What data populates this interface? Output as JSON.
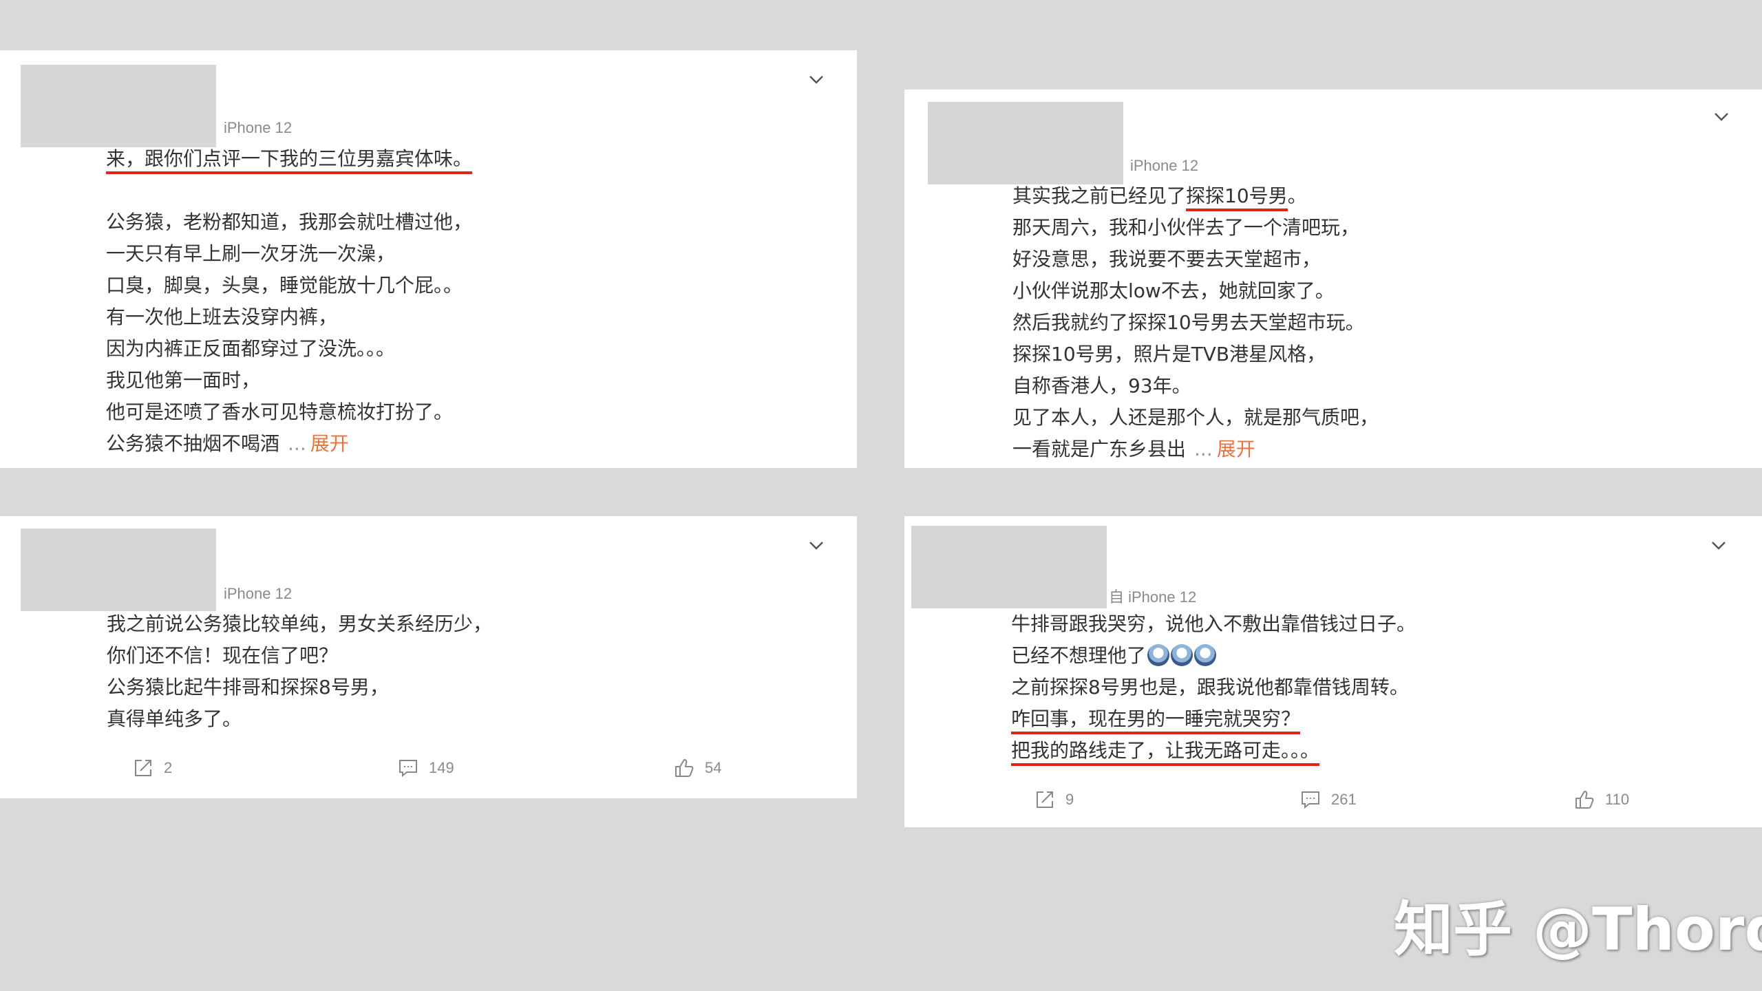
{
  "watermark": "知乎 @Thord",
  "cards": [
    {
      "device": "iPhone 12",
      "headline": "来，跟你们点评一下我的三位男嘉宾体味。",
      "lines": [
        "公务猿，老粉都知道，我那会就吐槽过他，",
        "一天只有早上刷一次牙洗一次澡，",
        "口臭，脚臭，头臭，睡觉能放十几个屁。。",
        "有一次他上班去没穿内裤，",
        "因为内裤正反面都穿过了没洗。。。",
        "我见他第一面时，",
        "他可是还喷了香水可见特意梳妆打扮了。",
        "公务猿不抽烟不喝酒"
      ],
      "more": "...",
      "expand": "展开"
    },
    {
      "device": "iPhone 12",
      "first_prefix": "其实我之前已经见了",
      "first_highlight": "探探10号男",
      "first_suffix": "。",
      "lines": [
        "那天周六，我和小伙伴去了一个清吧玩，",
        "好没意思，我说要不要去天堂超市，",
        "小伙伴说那太low不去，她就回家了。",
        "然后我就约了探探10号男去天堂超市玩。",
        "探探10号男，照片是TVB港星风格，",
        "自称香港人，93年。",
        "见了本人，人还是那个人，就是那气质吧，",
        "一看就是广东乡县出"
      ],
      "more": "...",
      "expand": "展开"
    },
    {
      "device": "iPhone 12",
      "lines": [
        "我之前说公务猿比较单纯，男女关系经历少，",
        "你们还不信！现在信了吧？",
        "公务猿比起牛排哥和探探8号男，",
        "真得单纯多了。"
      ],
      "share_count": "2",
      "comment_count": "149",
      "like_count": "54"
    },
    {
      "device": "自 iPhone 12",
      "lines": [
        "牛排哥跟我哭穷，说他入不敷出靠借钱过日子。",
        "已经不想理他了",
        "之前探探8号男也是，跟我说他都靠借钱周转。"
      ],
      "highlight_lines": [
        "咋回事，现在男的一睡完就哭穷？",
        "把我的路线走了，让我无路可走。。。"
      ],
      "share_count": "9",
      "comment_count": "261",
      "like_count": "110"
    }
  ],
  "icons": {
    "chevron": "chevron-down-icon",
    "share": "share-icon",
    "comment": "comment-icon",
    "like": "thumbs-up-icon",
    "emoji": "crying-face-emoji-icon"
  },
  "colors": {
    "background": "#d9d9d9",
    "card": "#ffffff",
    "underline": "#e2231a",
    "expand": "#e8733c",
    "meta": "#8a8a8a"
  }
}
